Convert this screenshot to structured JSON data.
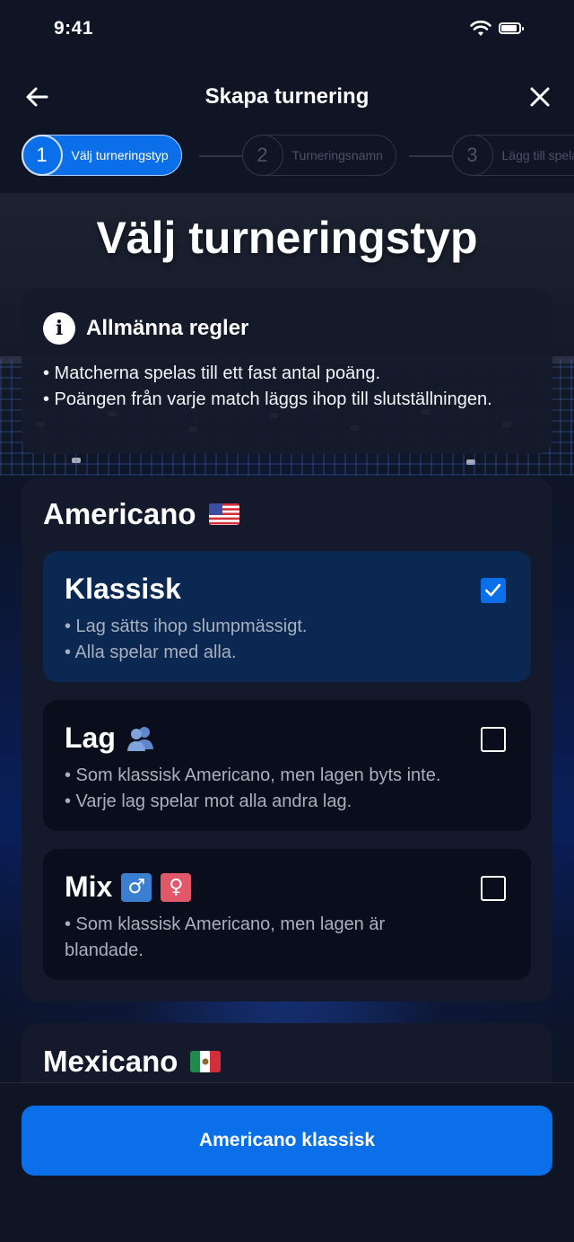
{
  "status_bar": {
    "time": "9:41"
  },
  "header": {
    "title": "Skapa turnering"
  },
  "stepper": {
    "steps": [
      {
        "number": "1",
        "label": "Välj turneringstyp",
        "active": true
      },
      {
        "number": "2",
        "label": "Turneringsnamn",
        "active": false
      },
      {
        "number": "3",
        "label": "Lägg till spelare",
        "active": false
      }
    ]
  },
  "heading": "Välj turneringstyp",
  "rules": {
    "title": "Allmänna regler",
    "lines": [
      "• Matcherna spelas till ett fast antal poäng.",
      "• Poängen från varje match läggs ihop till slutställningen."
    ]
  },
  "americano": {
    "title": "Americano",
    "options": [
      {
        "title": "Klassisk",
        "checked": true,
        "desc": [
          "• Lag sätts ihop slumpmässigt.",
          "• Alla spelar med alla."
        ]
      },
      {
        "title": "Lag",
        "checked": false,
        "desc": [
          "• Som klassisk Americano, men lagen byts inte.",
          "• Varje lag spelar mot alla andra lag."
        ]
      },
      {
        "title": "Mix",
        "checked": false,
        "desc": [
          "• Som klassisk Americano, men lagen är blandade."
        ]
      }
    ]
  },
  "mexicano": {
    "title": "Mexicano"
  },
  "cta": {
    "label": "Americano klassisk"
  },
  "colors": {
    "accent": "#0a6fe8",
    "background": "#0f1524",
    "card": "#141a2b",
    "selected_option": "#0b2852"
  },
  "icons": [
    "back-arrow-icon",
    "close-icon",
    "info-icon",
    "checkbox-checked-icon",
    "checkbox-empty-icon",
    "people-icon",
    "male-sign-icon",
    "female-sign-icon",
    "us-flag-icon",
    "mexico-flag-icon",
    "wifi-icon",
    "battery-icon"
  ]
}
